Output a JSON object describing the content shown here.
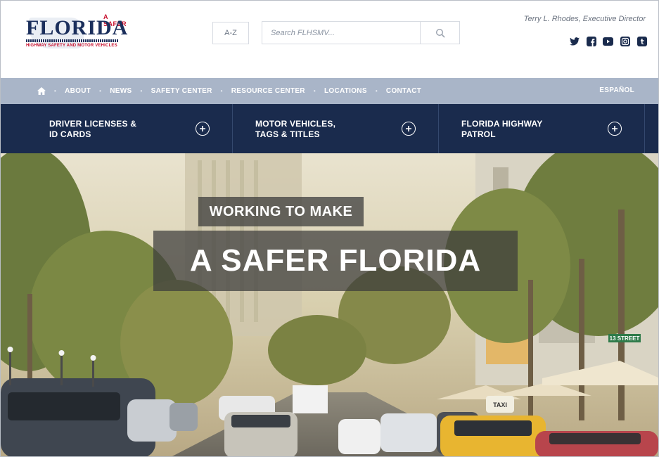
{
  "header": {
    "logo": {
      "tagline": "A SAFER",
      "wordmark": "FLORIDA",
      "subtitle": "HIGHWAY SAFETY AND MOTOR VEHICLES"
    },
    "az_label": "A-Z",
    "search": {
      "placeholder": "Search FLHSMV..."
    },
    "director": "Terry L. Rhodes, Executive Director",
    "social_icons": [
      "twitter-icon",
      "facebook-icon",
      "youtube-icon",
      "instagram-icon",
      "tumblr-icon"
    ]
  },
  "topnav": {
    "items": [
      "ABOUT",
      "NEWS",
      "SAFETY CENTER",
      "RESOURCE CENTER",
      "LOCATIONS",
      "CONTACT"
    ],
    "language": "ESPAÑOL"
  },
  "mainnav": {
    "items": [
      {
        "line1": "DRIVER LICENSES &",
        "line2": "ID CARDS"
      },
      {
        "line1": "MOTOR VEHICLES,",
        "line2": "TAGS & TITLES"
      },
      {
        "line1": "FLORIDA HIGHWAY",
        "line2": "PATROL"
      }
    ]
  },
  "hero": {
    "kicker": "WORKING TO MAKE",
    "title": "A SAFER FLORIDA",
    "street_sign": "13 STREET",
    "taxi_roof": "TAXI"
  },
  "colors": {
    "navy": "#1a2b4d",
    "topnav_bg": "#a9b5c8",
    "brand_red": "#c8102e",
    "brand_blue": "#1b2f5c"
  }
}
